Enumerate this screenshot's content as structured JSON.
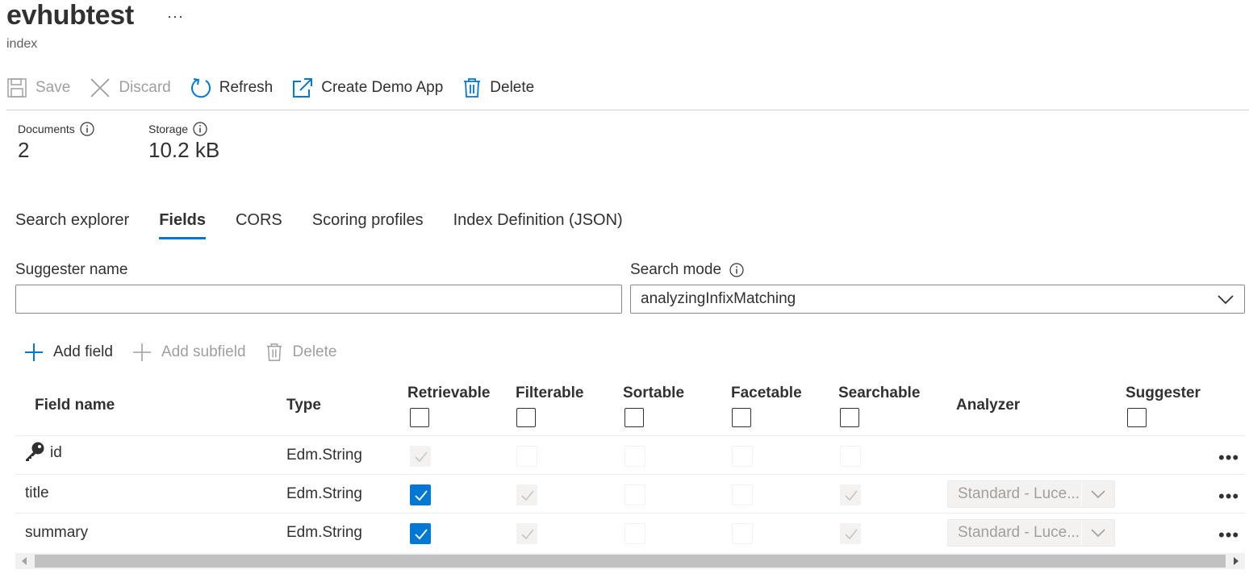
{
  "header": {
    "title": "evhubtest",
    "more": "···",
    "subtitle": "index"
  },
  "toolbar": {
    "save": "Save",
    "discard": "Discard",
    "refresh": "Refresh",
    "create_demo": "Create Demo App",
    "delete": "Delete"
  },
  "stats": {
    "documents_label": "Documents",
    "documents_value": "2",
    "storage_label": "Storage",
    "storage_value": "10.2 kB"
  },
  "tabs": [
    {
      "label": "Search explorer"
    },
    {
      "label": "Fields",
      "active": true
    },
    {
      "label": "CORS"
    },
    {
      "label": "Scoring profiles"
    },
    {
      "label": "Index Definition (JSON)"
    }
  ],
  "form": {
    "suggester_label": "Suggester name",
    "suggester_value": "",
    "search_mode_label": "Search mode",
    "search_mode_value": "analyzingInfixMatching"
  },
  "commands": {
    "add_field": "Add field",
    "add_subfield": "Add subfield",
    "delete": "Delete"
  },
  "table": {
    "headers": {
      "field_name": "Field name",
      "type": "Type",
      "retrievable": "Retrievable",
      "filterable": "Filterable",
      "sortable": "Sortable",
      "facetable": "Facetable",
      "searchable": "Searchable",
      "analyzer": "Analyzer",
      "suggester": "Suggester"
    },
    "rows": [
      {
        "name": "id",
        "type": "Edm.String",
        "key": true,
        "retrievable": "disabled-checked",
        "filterable": "disabled",
        "sortable": "disabled",
        "facetable": "disabled",
        "searchable": "disabled",
        "analyzer": ""
      },
      {
        "name": "title",
        "type": "Edm.String",
        "key": false,
        "retrievable": "checked",
        "filterable": "disabled-checked",
        "sortable": "disabled",
        "facetable": "disabled",
        "searchable": "disabled-checked",
        "analyzer": "Standard - Luce..."
      },
      {
        "name": "summary",
        "type": "Edm.String",
        "key": false,
        "retrievable": "checked",
        "filterable": "disabled-checked",
        "sortable": "disabled",
        "facetable": "disabled",
        "searchable": "disabled-checked",
        "analyzer": "Standard - Luce..."
      }
    ],
    "row_more": "•••"
  },
  "colors": {
    "accent": "#0078d4",
    "text": "#323130",
    "disabled_text": "#a19f9d"
  }
}
